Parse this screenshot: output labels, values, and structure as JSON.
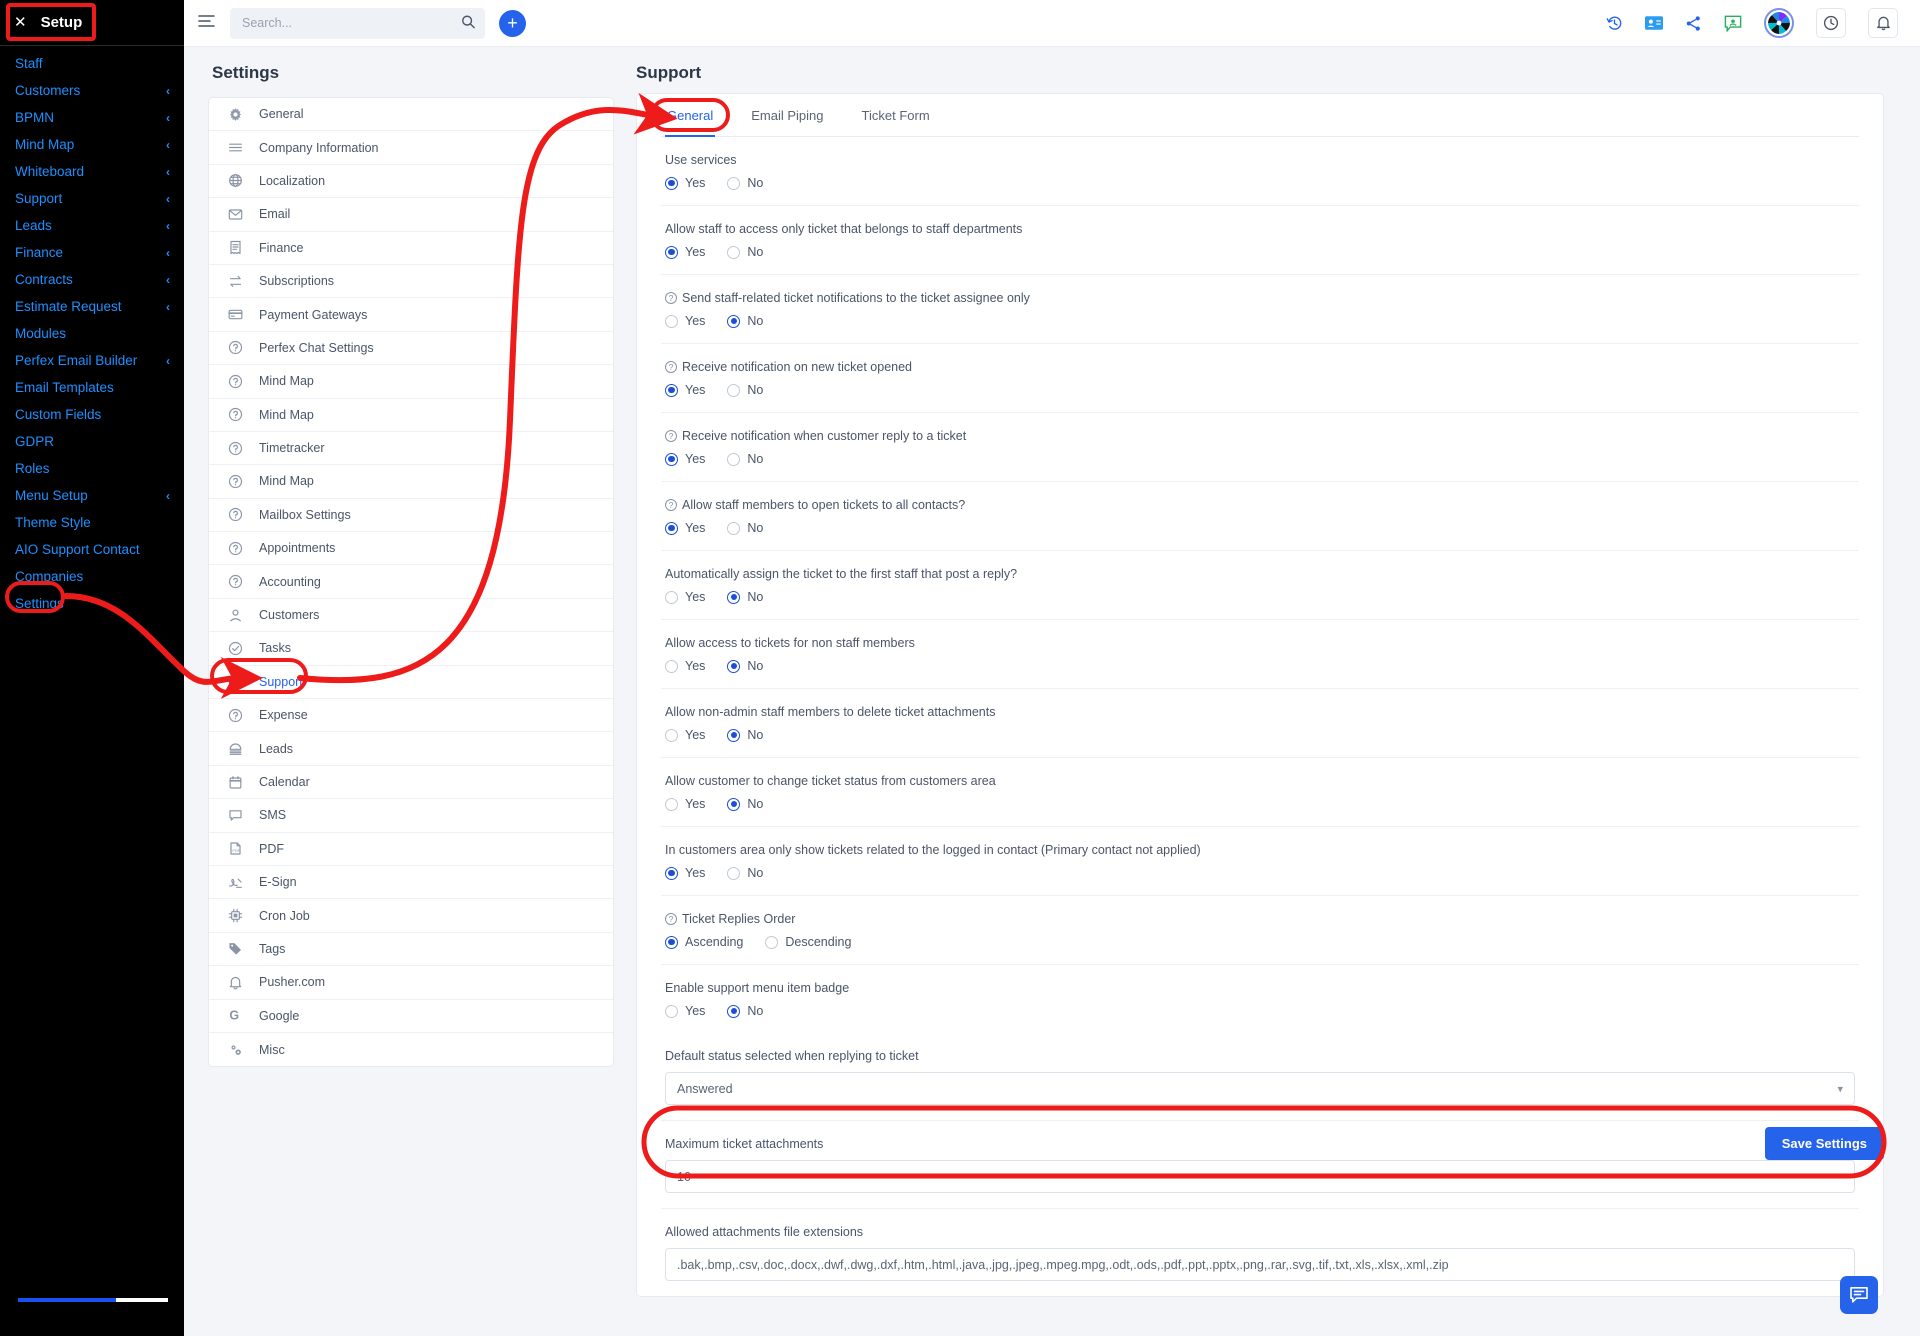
{
  "sidebar": {
    "close_label": "Setup",
    "close_icon": "close-icon",
    "items": [
      {
        "label": "Staff",
        "expandable": false
      },
      {
        "label": "Customers",
        "expandable": true
      },
      {
        "label": "BPMN",
        "expandable": true
      },
      {
        "label": "Mind Map",
        "expandable": true
      },
      {
        "label": "Whiteboard",
        "expandable": true
      },
      {
        "label": "Support",
        "expandable": true
      },
      {
        "label": "Leads",
        "expandable": true
      },
      {
        "label": "Finance",
        "expandable": true
      },
      {
        "label": "Contracts",
        "expandable": true
      },
      {
        "label": "Estimate Request",
        "expandable": true
      },
      {
        "label": "Modules",
        "expandable": false
      },
      {
        "label": "Perfex Email Builder",
        "expandable": true
      },
      {
        "label": "Email Templates",
        "expandable": false
      },
      {
        "label": "Custom Fields",
        "expandable": false
      },
      {
        "label": "GDPR",
        "expandable": false
      },
      {
        "label": "Roles",
        "expandable": false
      },
      {
        "label": "Menu Setup",
        "expandable": true
      },
      {
        "label": "Theme Style",
        "expandable": false
      },
      {
        "label": "AIO Support Contact",
        "expandable": false
      },
      {
        "label": "Companies",
        "expandable": false
      },
      {
        "label": "Settings",
        "expandable": false
      }
    ],
    "chevron_glyph": "‹"
  },
  "topbar": {
    "menu_icon": "hamburger-menu-icon",
    "search": {
      "value": "",
      "placeholder": "Search..."
    },
    "search_icon": "search-icon",
    "add_button_glyph": "+",
    "right_icons": [
      "history-icon",
      "contact-card-icon",
      "share-icon",
      "chat-user-icon",
      "app-logo-icon",
      "clock-icon",
      "bell-icon"
    ]
  },
  "settings_panel": {
    "title": "Settings",
    "items": [
      {
        "label": "General",
        "icon": "gear-icon",
        "active": false
      },
      {
        "label": "Company Information",
        "icon": "list-icon",
        "active": false
      },
      {
        "label": "Localization",
        "icon": "globe-icon",
        "active": false
      },
      {
        "label": "Email",
        "icon": "envelope-icon",
        "active": false
      },
      {
        "label": "Finance",
        "icon": "receipt-icon",
        "active": false
      },
      {
        "label": "Subscriptions",
        "icon": "refresh-icon",
        "active": false
      },
      {
        "label": "Payment Gateways",
        "icon": "credit-card-icon",
        "active": false
      },
      {
        "label": "Perfex Chat Settings",
        "icon": "question-circle-icon",
        "active": false
      },
      {
        "label": "Mind Map",
        "icon": "question-circle-icon",
        "active": false
      },
      {
        "label": "Mind Map",
        "icon": "question-circle-icon",
        "active": false
      },
      {
        "label": "Timetracker",
        "icon": "question-circle-icon",
        "active": false
      },
      {
        "label": "Mind Map",
        "icon": "question-circle-icon",
        "active": false
      },
      {
        "label": "Mailbox Settings",
        "icon": "question-circle-icon",
        "active": false
      },
      {
        "label": "Appointments",
        "icon": "question-circle-icon",
        "active": false
      },
      {
        "label": "Accounting",
        "icon": "question-circle-icon",
        "active": false
      },
      {
        "label": "Customers",
        "icon": "user-icon",
        "active": false
      },
      {
        "label": "Tasks",
        "icon": "check-circle-icon",
        "active": false
      },
      {
        "label": "Support",
        "icon": "lifebuoy-icon",
        "active": true
      },
      {
        "label": "Expense",
        "icon": "question-circle-icon",
        "active": false
      },
      {
        "label": "Leads",
        "icon": "leads-icon",
        "active": false
      },
      {
        "label": "Calendar",
        "icon": "calendar-icon",
        "active": false
      },
      {
        "label": "SMS",
        "icon": "speech-bubble-icon",
        "active": false
      },
      {
        "label": "PDF",
        "icon": "pdf-icon",
        "active": false
      },
      {
        "label": "E-Sign",
        "icon": "signature-icon",
        "active": false
      },
      {
        "label": "Cron Job",
        "icon": "chip-icon",
        "active": false
      },
      {
        "label": "Tags",
        "icon": "tag-icon",
        "active": false
      },
      {
        "label": "Pusher.com",
        "icon": "bell-icon",
        "active": false
      },
      {
        "label": "Google",
        "icon": "google-icon",
        "active": false
      },
      {
        "label": "Misc",
        "icon": "gears-icon",
        "active": false
      }
    ]
  },
  "support": {
    "title": "Support",
    "tabs": [
      {
        "label": "General",
        "active": true
      },
      {
        "label": "Email Piping",
        "active": false
      },
      {
        "label": "Ticket Form",
        "active": false
      }
    ],
    "fields": [
      {
        "label": "Use services",
        "help": false,
        "options": [
          {
            "label": "Yes",
            "selected": true
          },
          {
            "label": "No",
            "selected": false
          }
        ]
      },
      {
        "label": "Allow staff to access only ticket that belongs to staff departments",
        "help": false,
        "options": [
          {
            "label": "Yes",
            "selected": true
          },
          {
            "label": "No",
            "selected": false
          }
        ]
      },
      {
        "label": "Send staff-related ticket notifications to the ticket assignee only",
        "help": true,
        "options": [
          {
            "label": "Yes",
            "selected": false
          },
          {
            "label": "No",
            "selected": true
          }
        ]
      },
      {
        "label": "Receive notification on new ticket opened",
        "help": true,
        "options": [
          {
            "label": "Yes",
            "selected": true
          },
          {
            "label": "No",
            "selected": false
          }
        ]
      },
      {
        "label": "Receive notification when customer reply to a ticket",
        "help": true,
        "options": [
          {
            "label": "Yes",
            "selected": true
          },
          {
            "label": "No",
            "selected": false
          }
        ]
      },
      {
        "label": "Allow staff members to open tickets to all contacts?",
        "help": true,
        "options": [
          {
            "label": "Yes",
            "selected": true
          },
          {
            "label": "No",
            "selected": false
          }
        ]
      },
      {
        "label": "Automatically assign the ticket to the first staff that post a reply?",
        "help": false,
        "options": [
          {
            "label": "Yes",
            "selected": false
          },
          {
            "label": "No",
            "selected": true
          }
        ]
      },
      {
        "label": "Allow access to tickets for non staff members",
        "help": false,
        "options": [
          {
            "label": "Yes",
            "selected": false
          },
          {
            "label": "No",
            "selected": true
          }
        ]
      },
      {
        "label": "Allow non-admin staff members to delete ticket attachments",
        "help": false,
        "options": [
          {
            "label": "Yes",
            "selected": false
          },
          {
            "label": "No",
            "selected": true
          }
        ]
      },
      {
        "label": "Allow customer to change ticket status from customers area",
        "help": false,
        "options": [
          {
            "label": "Yes",
            "selected": false
          },
          {
            "label": "No",
            "selected": true
          }
        ]
      },
      {
        "label": "In customers area only show tickets related to the logged in contact (Primary contact not applied)",
        "help": false,
        "options": [
          {
            "label": "Yes",
            "selected": true
          },
          {
            "label": "No",
            "selected": false
          }
        ]
      },
      {
        "label": "Ticket Replies Order",
        "help": true,
        "options": [
          {
            "label": "Ascending",
            "selected": true
          },
          {
            "label": "Descending",
            "selected": false
          }
        ]
      },
      {
        "label": "Enable support menu item badge",
        "help": false,
        "options": [
          {
            "label": "Yes",
            "selected": false
          },
          {
            "label": "No",
            "selected": true
          }
        ]
      }
    ],
    "default_status": {
      "label": "Default status selected when replying to ticket",
      "value": "Answered"
    },
    "max_attachments": {
      "label": "Maximum ticket attachments",
      "value": "10"
    },
    "allowed_extensions": {
      "label": "Allowed attachments file extensions",
      "value": ".bak,.bmp,.csv,.doc,.docx,.dwf,.dwg,.dxf,.htm,.html,.java,.jpg,.jpeg,.mpeg.mpg,.odt,.ods,.pdf,.ppt,.pptx,.png,.rar,.svg,.tif,.txt,.xls,.xlsx,.xml,.zip"
    },
    "save_label": "Save Settings"
  },
  "chat_fab": {
    "icon": "chat-icon"
  },
  "colors": {
    "accent": "#2563eb",
    "sidebar_bg": "#000000",
    "sidebar_link": "#1e90ff",
    "annotation": "#ee1b1b",
    "page_bg": "#f3f5f9"
  }
}
